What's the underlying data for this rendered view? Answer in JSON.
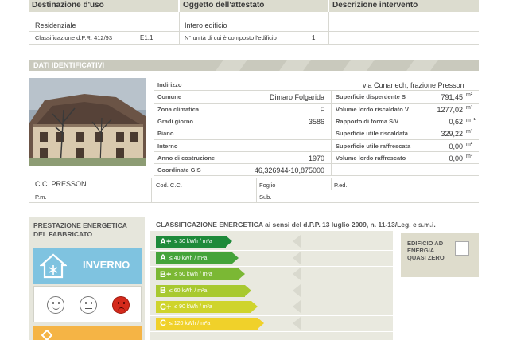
{
  "header": {
    "destinazione": "Destinazione d'uso",
    "oggetto": "Oggetto dell'attestato",
    "descrizione": "Descrizione intervento"
  },
  "row1": {
    "destinazione_value": "Residenziale",
    "oggetto_value": "Intero edificio",
    "classificazione_label": "Classificazione d.P.R. 412/93",
    "classificazione_value": "E1.1",
    "unita_label": "N° unità di cui è composto l'edificio",
    "unita_value": "1"
  },
  "dati_title": "DATI IDENTIFICATIVI",
  "dati": {
    "left": [
      {
        "label": "Indirizzo",
        "value": ""
      },
      {
        "label": "Comune",
        "value": "Dimaro Folgarida"
      },
      {
        "label": "Zona climatica",
        "value": "F"
      },
      {
        "label": "Gradi giorno",
        "value": "3586"
      },
      {
        "label": "Piano",
        "value": ""
      },
      {
        "label": "Interno",
        "value": ""
      },
      {
        "label": "Anno di costruzione",
        "value": "1970"
      },
      {
        "label": "Coordinate GIS",
        "value": "46,326944-10,875000"
      }
    ],
    "indirizzo_value": "via Cunanech, frazione Presson",
    "right": [
      {
        "label": "Superficie disperdente S",
        "value": "791,45",
        "unit": "m²"
      },
      {
        "label": "Volume lordo riscaldato V",
        "value": "1277,02",
        "unit": "m³"
      },
      {
        "label": "Rapporto di forma S/V",
        "value": "0,62",
        "unit": "m⁻¹"
      },
      {
        "label": "Superficie utile riscaldata",
        "value": "329,22",
        "unit": "m²"
      },
      {
        "label": "Superficie utile raffrescata",
        "value": "0,00",
        "unit": "m²"
      },
      {
        "label": "Volume lordo raffrescato",
        "value": "0,00",
        "unit": "m³"
      }
    ]
  },
  "catasto": {
    "cc": "C.C. PRESSON",
    "cod_cc": "Cod. C.C.",
    "foglio": "Foglio",
    "ped": "P.ed.",
    "pm": "P.m.",
    "sub": "Sub."
  },
  "prestazione": {
    "title_line1": "PRESTAZIONE ENERGETICA",
    "title_line2": "DEL FABBRICATO",
    "inverno": "INVERNO"
  },
  "classificazione": {
    "title": "CLASSIFICAZIONE ENERGETICA ai sensi del d.P.P. 13 luglio 2009, n. 11-13/Leg. e s.m.i.",
    "classes": [
      {
        "name": "A+",
        "limit": "≤ 30 kWh / m²a",
        "color": "#1e8a3a"
      },
      {
        "name": "A",
        "limit": "≤ 40 kWh / m²a",
        "color": "#44a33a"
      },
      {
        "name": "B+",
        "limit": "≤ 50 kWh / m²a",
        "color": "#7bb834"
      },
      {
        "name": "B",
        "limit": "≤ 60 kWh / m²a",
        "color": "#a8c92f"
      },
      {
        "name": "C+",
        "limit": "≤ 90 kWh / m²a",
        "color": "#cfd42c"
      },
      {
        "name": "C",
        "limit": "≤ 120 kWh / m²a",
        "color": "#f0d12a"
      }
    ]
  },
  "nzeb": {
    "line1": "EDIFICIO AD",
    "line2": "ENERGIA",
    "line3": "QUASI ZERO"
  }
}
